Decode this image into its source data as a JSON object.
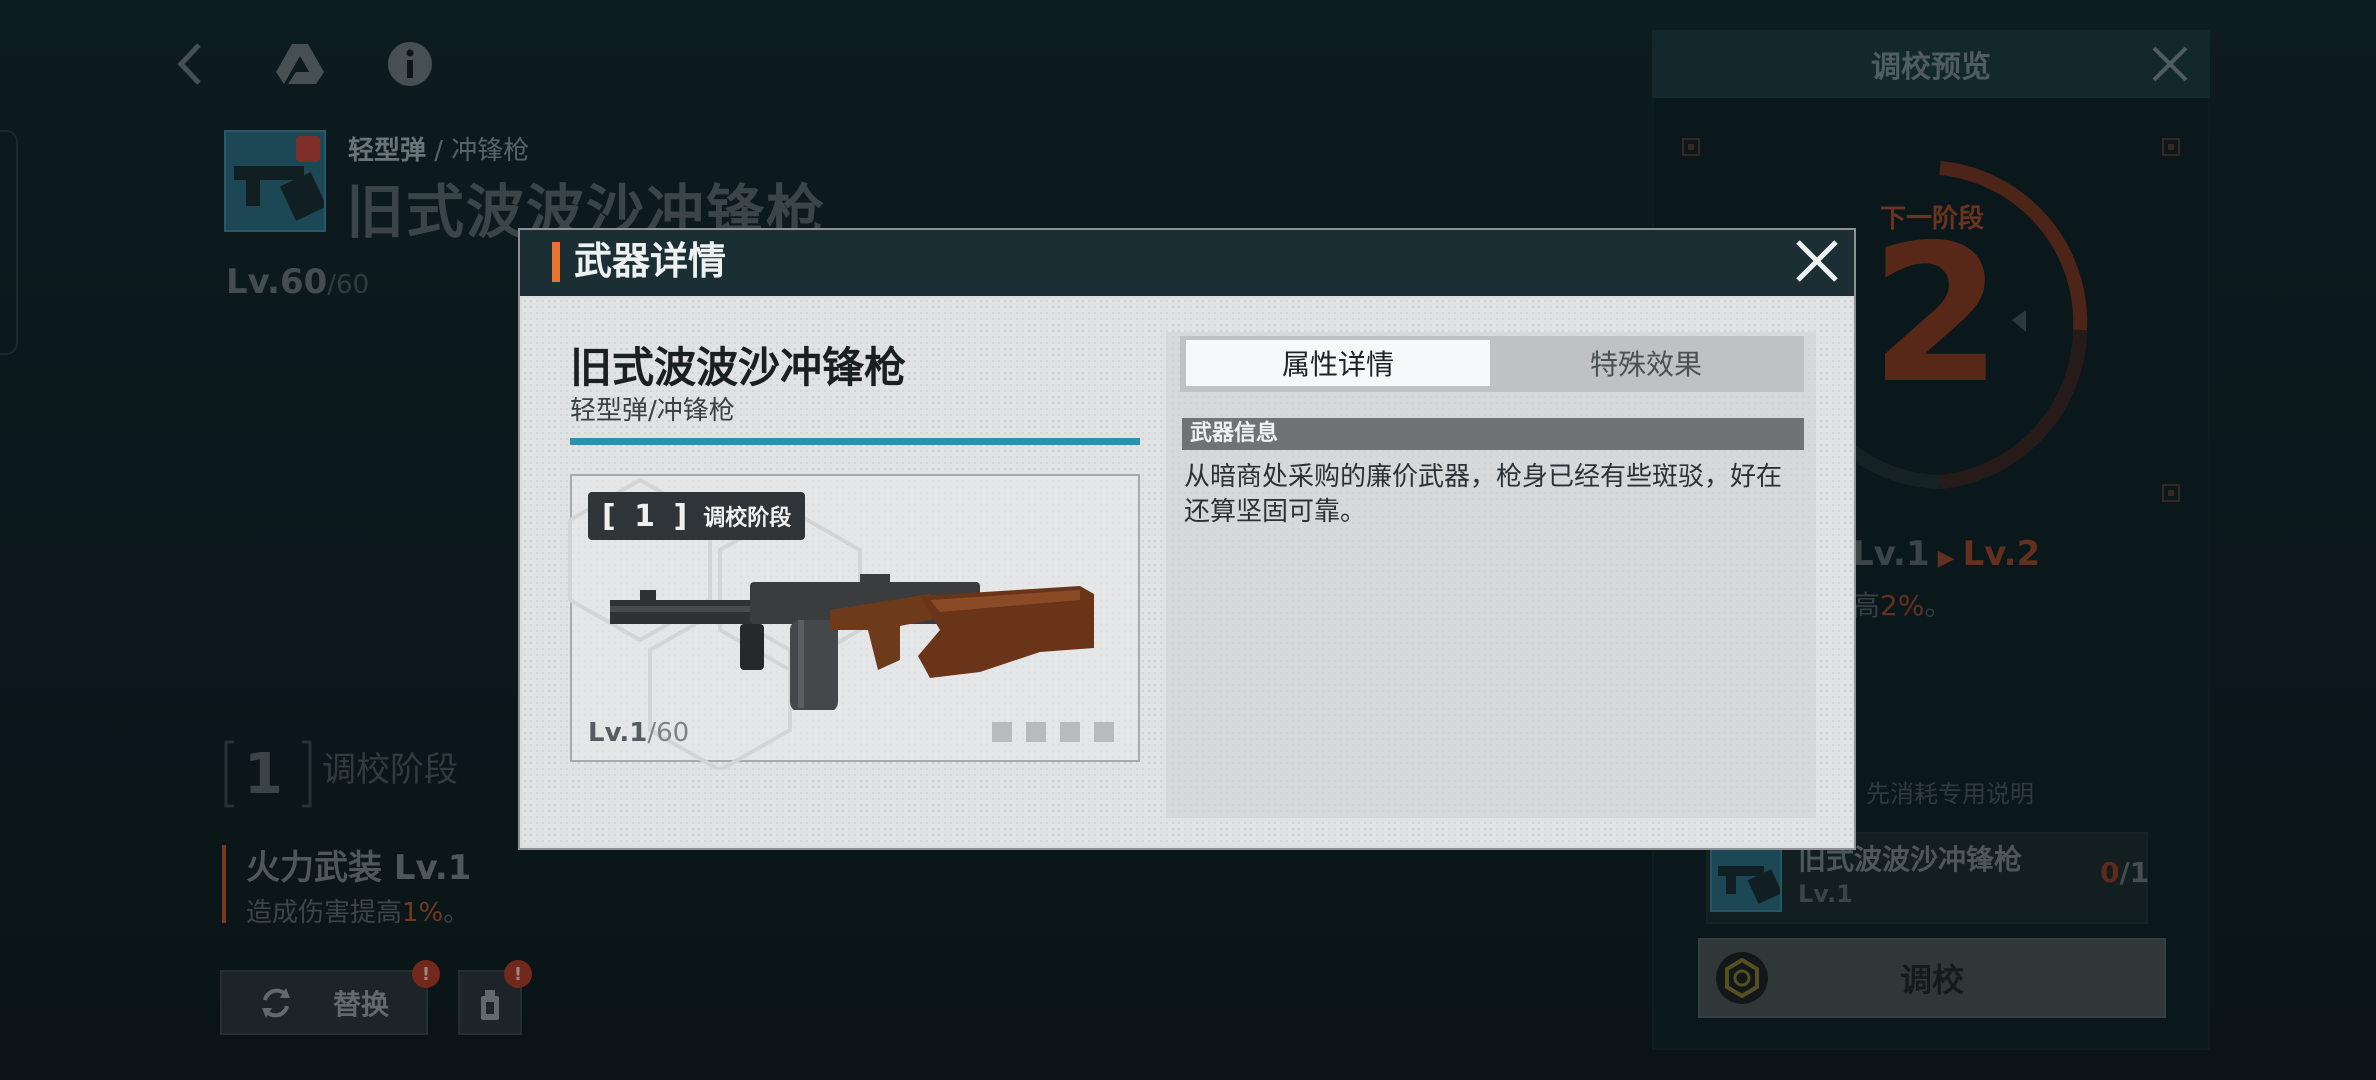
{
  "nav": {
    "back_icon": "chevron-left-icon",
    "drive_icon": "triangle-logo-icon",
    "info_icon": "info-icon"
  },
  "background": {
    "weapon_category": "轻型弹",
    "weapon_subcategory": "/ 冲锋枪",
    "weapon_title": "旧式波波沙冲锋枪",
    "level_current": "Lv.60",
    "level_max": "/60",
    "stage_number": "1",
    "stage_label": "调校阶段",
    "perk_title": "火力武装 Lv.1",
    "perk_desc_prefix": "造成伤害提高",
    "perk_desc_value": "1%",
    "perk_desc_suffix": "。",
    "swap_button": "替换",
    "swap_badge": "!",
    "small_badge": "!"
  },
  "right_panel": {
    "title": "调校预览",
    "next_stage_label": "下一阶段",
    "next_stage_number": "2",
    "level_from": "Lv.1",
    "level_to": "Lv.2",
    "perk_prefix": "高",
    "perk_value": "2%",
    "perk_suffix": "。",
    "consume_note": "先消耗专用说明",
    "material_name": "旧式波波沙冲锋枪",
    "material_level": "Lv.1",
    "material_have": "0",
    "material_need": "/1",
    "tune_button": "调校"
  },
  "modal": {
    "title": "武器详情",
    "weapon_name": "旧式波波沙冲锋枪",
    "weapon_type": "轻型弹/冲锋枪",
    "stage_tag_number": "[ 1 ]",
    "stage_tag_label": "调校阶段",
    "level": "Lv.1",
    "level_max": "/60",
    "tabs": [
      {
        "label": "属性详情",
        "active": true
      },
      {
        "label": "特殊效果",
        "active": false
      }
    ],
    "info_heading": "武器信息",
    "info_text": "从暗商处采购的廉价武器，枪身已经有些斑驳，好在还算坚固可靠。"
  },
  "colors": {
    "accent_orange": "#e9742f",
    "accent_teal": "#2a93aa",
    "warning_red": "#b53a25"
  }
}
